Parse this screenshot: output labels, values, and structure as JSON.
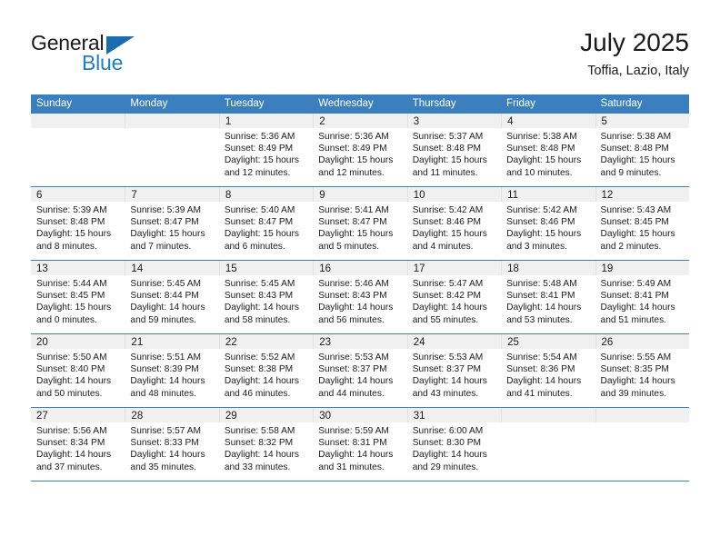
{
  "brand": {
    "name_top": "General",
    "name_bottom": "Blue",
    "triangle_color": "#1c6cb0",
    "blue_color": "#1c7fc4"
  },
  "header": {
    "title": "July 2025",
    "subtitle": "Toffia, Lazio, Italy"
  },
  "theme": {
    "header_row_bg": "#3c7fbe",
    "header_row_text": "#ffffff",
    "daynum_band_bg": "#f0f0f0",
    "cell_text": "#1a1a1a",
    "page_bg": "#ffffff"
  },
  "weekday_headers": [
    "Sunday",
    "Monday",
    "Tuesday",
    "Wednesday",
    "Thursday",
    "Friday",
    "Saturday"
  ],
  "weeks": [
    [
      {
        "day": "",
        "sunrise": "",
        "sunset": "",
        "daylight_line1": "",
        "daylight_line2": ""
      },
      {
        "day": "",
        "sunrise": "",
        "sunset": "",
        "daylight_line1": "",
        "daylight_line2": ""
      },
      {
        "day": "1",
        "sunrise": "Sunrise: 5:36 AM",
        "sunset": "Sunset: 8:49 PM",
        "daylight_line1": "Daylight: 15 hours",
        "daylight_line2": "and 12 minutes."
      },
      {
        "day": "2",
        "sunrise": "Sunrise: 5:36 AM",
        "sunset": "Sunset: 8:49 PM",
        "daylight_line1": "Daylight: 15 hours",
        "daylight_line2": "and 12 minutes."
      },
      {
        "day": "3",
        "sunrise": "Sunrise: 5:37 AM",
        "sunset": "Sunset: 8:48 PM",
        "daylight_line1": "Daylight: 15 hours",
        "daylight_line2": "and 11 minutes."
      },
      {
        "day": "4",
        "sunrise": "Sunrise: 5:38 AM",
        "sunset": "Sunset: 8:48 PM",
        "daylight_line1": "Daylight: 15 hours",
        "daylight_line2": "and 10 minutes."
      },
      {
        "day": "5",
        "sunrise": "Sunrise: 5:38 AM",
        "sunset": "Sunset: 8:48 PM",
        "daylight_line1": "Daylight: 15 hours",
        "daylight_line2": "and 9 minutes."
      }
    ],
    [
      {
        "day": "6",
        "sunrise": "Sunrise: 5:39 AM",
        "sunset": "Sunset: 8:48 PM",
        "daylight_line1": "Daylight: 15 hours",
        "daylight_line2": "and 8 minutes."
      },
      {
        "day": "7",
        "sunrise": "Sunrise: 5:39 AM",
        "sunset": "Sunset: 8:47 PM",
        "daylight_line1": "Daylight: 15 hours",
        "daylight_line2": "and 7 minutes."
      },
      {
        "day": "8",
        "sunrise": "Sunrise: 5:40 AM",
        "sunset": "Sunset: 8:47 PM",
        "daylight_line1": "Daylight: 15 hours",
        "daylight_line2": "and 6 minutes."
      },
      {
        "day": "9",
        "sunrise": "Sunrise: 5:41 AM",
        "sunset": "Sunset: 8:47 PM",
        "daylight_line1": "Daylight: 15 hours",
        "daylight_line2": "and 5 minutes."
      },
      {
        "day": "10",
        "sunrise": "Sunrise: 5:42 AM",
        "sunset": "Sunset: 8:46 PM",
        "daylight_line1": "Daylight: 15 hours",
        "daylight_line2": "and 4 minutes."
      },
      {
        "day": "11",
        "sunrise": "Sunrise: 5:42 AM",
        "sunset": "Sunset: 8:46 PM",
        "daylight_line1": "Daylight: 15 hours",
        "daylight_line2": "and 3 minutes."
      },
      {
        "day": "12",
        "sunrise": "Sunrise: 5:43 AM",
        "sunset": "Sunset: 8:45 PM",
        "daylight_line1": "Daylight: 15 hours",
        "daylight_line2": "and 2 minutes."
      }
    ],
    [
      {
        "day": "13",
        "sunrise": "Sunrise: 5:44 AM",
        "sunset": "Sunset: 8:45 PM",
        "daylight_line1": "Daylight: 15 hours",
        "daylight_line2": "and 0 minutes."
      },
      {
        "day": "14",
        "sunrise": "Sunrise: 5:45 AM",
        "sunset": "Sunset: 8:44 PM",
        "daylight_line1": "Daylight: 14 hours",
        "daylight_line2": "and 59 minutes."
      },
      {
        "day": "15",
        "sunrise": "Sunrise: 5:45 AM",
        "sunset": "Sunset: 8:43 PM",
        "daylight_line1": "Daylight: 14 hours",
        "daylight_line2": "and 58 minutes."
      },
      {
        "day": "16",
        "sunrise": "Sunrise: 5:46 AM",
        "sunset": "Sunset: 8:43 PM",
        "daylight_line1": "Daylight: 14 hours",
        "daylight_line2": "and 56 minutes."
      },
      {
        "day": "17",
        "sunrise": "Sunrise: 5:47 AM",
        "sunset": "Sunset: 8:42 PM",
        "daylight_line1": "Daylight: 14 hours",
        "daylight_line2": "and 55 minutes."
      },
      {
        "day": "18",
        "sunrise": "Sunrise: 5:48 AM",
        "sunset": "Sunset: 8:41 PM",
        "daylight_line1": "Daylight: 14 hours",
        "daylight_line2": "and 53 minutes."
      },
      {
        "day": "19",
        "sunrise": "Sunrise: 5:49 AM",
        "sunset": "Sunset: 8:41 PM",
        "daylight_line1": "Daylight: 14 hours",
        "daylight_line2": "and 51 minutes."
      }
    ],
    [
      {
        "day": "20",
        "sunrise": "Sunrise: 5:50 AM",
        "sunset": "Sunset: 8:40 PM",
        "daylight_line1": "Daylight: 14 hours",
        "daylight_line2": "and 50 minutes."
      },
      {
        "day": "21",
        "sunrise": "Sunrise: 5:51 AM",
        "sunset": "Sunset: 8:39 PM",
        "daylight_line1": "Daylight: 14 hours",
        "daylight_line2": "and 48 minutes."
      },
      {
        "day": "22",
        "sunrise": "Sunrise: 5:52 AM",
        "sunset": "Sunset: 8:38 PM",
        "daylight_line1": "Daylight: 14 hours",
        "daylight_line2": "and 46 minutes."
      },
      {
        "day": "23",
        "sunrise": "Sunrise: 5:53 AM",
        "sunset": "Sunset: 8:37 PM",
        "daylight_line1": "Daylight: 14 hours",
        "daylight_line2": "and 44 minutes."
      },
      {
        "day": "24",
        "sunrise": "Sunrise: 5:53 AM",
        "sunset": "Sunset: 8:37 PM",
        "daylight_line1": "Daylight: 14 hours",
        "daylight_line2": "and 43 minutes."
      },
      {
        "day": "25",
        "sunrise": "Sunrise: 5:54 AM",
        "sunset": "Sunset: 8:36 PM",
        "daylight_line1": "Daylight: 14 hours",
        "daylight_line2": "and 41 minutes."
      },
      {
        "day": "26",
        "sunrise": "Sunrise: 5:55 AM",
        "sunset": "Sunset: 8:35 PM",
        "daylight_line1": "Daylight: 14 hours",
        "daylight_line2": "and 39 minutes."
      }
    ],
    [
      {
        "day": "27",
        "sunrise": "Sunrise: 5:56 AM",
        "sunset": "Sunset: 8:34 PM",
        "daylight_line1": "Daylight: 14 hours",
        "daylight_line2": "and 37 minutes."
      },
      {
        "day": "28",
        "sunrise": "Sunrise: 5:57 AM",
        "sunset": "Sunset: 8:33 PM",
        "daylight_line1": "Daylight: 14 hours",
        "daylight_line2": "and 35 minutes."
      },
      {
        "day": "29",
        "sunrise": "Sunrise: 5:58 AM",
        "sunset": "Sunset: 8:32 PM",
        "daylight_line1": "Daylight: 14 hours",
        "daylight_line2": "and 33 minutes."
      },
      {
        "day": "30",
        "sunrise": "Sunrise: 5:59 AM",
        "sunset": "Sunset: 8:31 PM",
        "daylight_line1": "Daylight: 14 hours",
        "daylight_line2": "and 31 minutes."
      },
      {
        "day": "31",
        "sunrise": "Sunrise: 6:00 AM",
        "sunset": "Sunset: 8:30 PM",
        "daylight_line1": "Daylight: 14 hours",
        "daylight_line2": "and 29 minutes."
      },
      {
        "day": "",
        "sunrise": "",
        "sunset": "",
        "daylight_line1": "",
        "daylight_line2": ""
      },
      {
        "day": "",
        "sunrise": "",
        "sunset": "",
        "daylight_line1": "",
        "daylight_line2": ""
      }
    ]
  ]
}
